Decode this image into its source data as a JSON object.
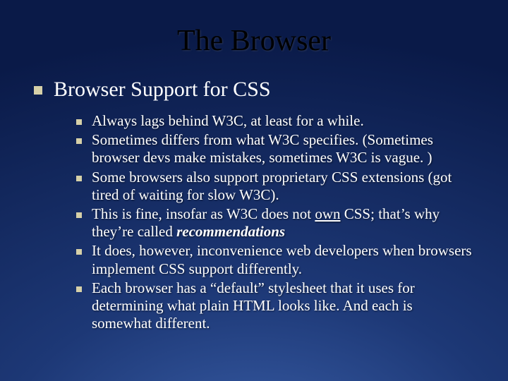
{
  "title": "The Browser",
  "heading": "Browser Support for CSS",
  "bullets": {
    "b0": "Always lags behind W3C, at least for a while.",
    "b1": "Sometimes differs from what W3C specifies.  (Sometimes browser devs make mistakes, sometimes W3C is vague. )",
    "b2": "Some browsers also support proprietary CSS extensions (got tired of waiting for slow W3C).",
    "b3_pre": "This is fine, insofar as W3C does not ",
    "b3_own": "own",
    "b3_mid": " CSS; that’s why they’re called ",
    "b3_rec": "recommendations",
    "b4": "It does, however, inconvenience web developers when browsers implement CSS support differently.",
    "b5": "Each browser has a “default” stylesheet that it uses for determining what plain HTML looks like.  And each is somewhat different."
  }
}
